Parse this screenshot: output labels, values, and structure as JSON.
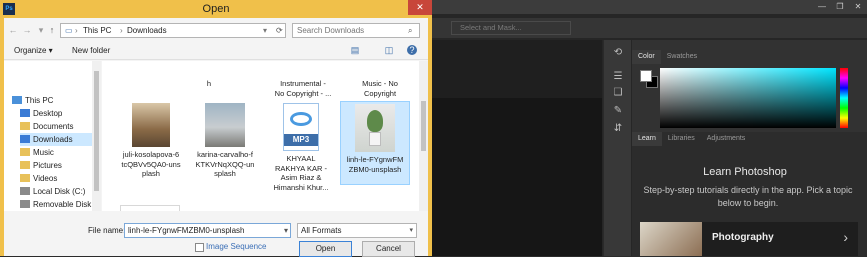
{
  "dialog": {
    "title": "Open",
    "close_label": "✕",
    "app_icon": "Ps",
    "address": {
      "segments": [
        "This PC",
        "Downloads"
      ],
      "separator": "›"
    },
    "search": {
      "placeholder": "Search Downloads"
    },
    "toolbar": {
      "organize": "Organize ▾",
      "new_folder": "New folder"
    },
    "nav_items": [
      {
        "label": "This PC",
        "icon": "computer-icon"
      },
      {
        "label": "Desktop",
        "icon": "folder-icon"
      },
      {
        "label": "Documents",
        "icon": "folder-icon"
      },
      {
        "label": "Downloads",
        "icon": "folder-icon",
        "selected": true
      },
      {
        "label": "Music",
        "icon": "folder-icon"
      },
      {
        "label": "Pictures",
        "icon": "folder-icon"
      },
      {
        "label": "Videos",
        "icon": "folder-icon"
      },
      {
        "label": "Local Disk (C:)",
        "icon": "disk-icon"
      },
      {
        "label": "Removable Disk",
        "icon": "disk-icon"
      }
    ],
    "files_top_row": [
      {
        "label": "h"
      },
      {
        "label": "Instrumental -\nNo Copyright - ..."
      },
      {
        "label": "Music - No\nCopyright"
      }
    ],
    "files": [
      {
        "label": "juli-kosolapova-6\ntcQBVv5QA0-uns\nplash",
        "kind": "photo-archway"
      },
      {
        "label": "karina-carvalho-f\nKTKVrNqXQQ-un\nsplash",
        "kind": "photo-person"
      },
      {
        "label": "KHYAAL\nRAKHYA KAR -\nAsim Riaz &\nHimanshi Khur...",
        "kind": "mp3",
        "badge": "MP3"
      },
      {
        "label": "linh-le-FYgnwFM\nZBM0-unsplash",
        "kind": "photo-plant",
        "selected": true
      }
    ],
    "bottom": {
      "file_name_label": "File name:",
      "file_name_value": "linh-le-FYgnwFMZBM0-unsplash",
      "format_value": "All Formats",
      "image_sequence_label": "Image Sequence",
      "open_label": "Open",
      "cancel_label": "Cancel"
    }
  },
  "photoshop": {
    "select_mask": "Select and Mask...",
    "window_controls": [
      "—",
      "❐",
      "✕"
    ],
    "color_tabs": [
      "Color",
      "Swatches"
    ],
    "learn_tabs": [
      "Learn",
      "Libraries",
      "Adjustments"
    ],
    "learn_title": "Learn Photoshop",
    "learn_desc": "Step-by-step tutorials directly in the app. Pick a topic below to begin.",
    "card_label": "Photography",
    "card_chevron": "›"
  },
  "colors": {
    "dialog_frame": "#f0c04a",
    "close": "#c8463a",
    "selection": "#cce8ff",
    "ps_dark": "#262626"
  }
}
